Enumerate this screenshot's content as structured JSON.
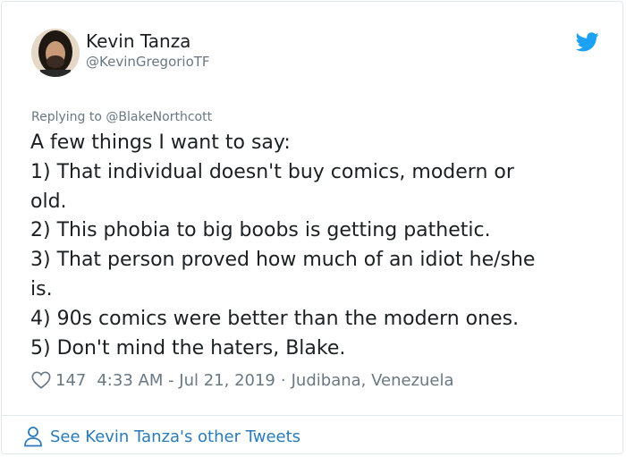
{
  "author": {
    "display_name": "Kevin Tanza",
    "handle": "@KevinGregorioTF"
  },
  "icons": {
    "brand": "twitter-bird-icon",
    "like": "heart-icon",
    "profile": "person-icon",
    "brand_color": "#1da1f2",
    "link_color": "#2b7bb9"
  },
  "tweet": {
    "reply_prefix": "Replying to",
    "reply_to": "@BlakeNorthcott",
    "lines": [
      "A few things I want to say:",
      "1) That individual doesn't buy comics, modern or",
      "old.",
      "2) This phobia to big boobs is getting pathetic.",
      "3) That person proved how much of an idiot he/she",
      "is.",
      "4) 90s comics were better than the modern ones.",
      "5) Don't mind the haters, Blake."
    ],
    "likes": "147",
    "timestamp": "4:33 AM - Jul 21, 2019",
    "separator": "·",
    "location": "Judibana, Venezuela"
  },
  "footer": {
    "see_more_label": "See Kevin Tanza's other Tweets"
  }
}
